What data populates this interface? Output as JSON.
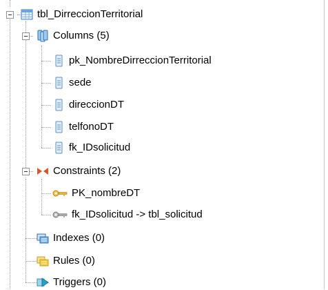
{
  "tree": {
    "root": {
      "label": "tbl_DirreccionTerritorial",
      "icon": "table-icon",
      "expanded": true,
      "columns": {
        "label": "Columns (5)",
        "icon": "columns-icon",
        "expanded": true,
        "items": [
          {
            "label": "pk_NombreDirreccionTerritorial",
            "icon": "column-icon"
          },
          {
            "label": "sede",
            "icon": "column-icon"
          },
          {
            "label": "direccionDT",
            "icon": "column-icon"
          },
          {
            "label": "telfonoDT",
            "icon": "column-icon"
          },
          {
            "label": "fk_IDsolicitud",
            "icon": "column-icon"
          }
        ]
      },
      "constraints": {
        "label": "Constraints (2)",
        "icon": "constraints-icon",
        "expanded": true,
        "items": [
          {
            "label": "PK_nombreDT",
            "icon": "primary-key-icon"
          },
          {
            "label": "fk_IDsolicitud -> tbl_solicitud",
            "icon": "foreign-key-icon"
          }
        ]
      },
      "indexes": {
        "label": "Indexes (0)",
        "icon": "indexes-icon"
      },
      "rules": {
        "label": "Rules (0)",
        "icon": "rules-icon"
      },
      "triggers": {
        "label": "Triggers (0)",
        "icon": "triggers-icon"
      }
    }
  }
}
